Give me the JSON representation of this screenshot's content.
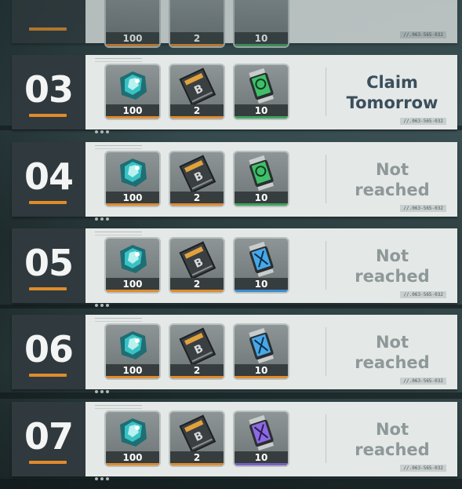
{
  "colors": {
    "orange": "#e08b2c",
    "green": "#3fa35c",
    "blue": "#3b8ccf",
    "purple": "#7a5fc0",
    "status_claim": "#3a4f5c",
    "status_locked": "#8e9898"
  },
  "partial_row": {
    "quantities": [
      "100",
      "2",
      "10"
    ],
    "code": "//.063-565-032"
  },
  "rows": [
    {
      "day": "03",
      "status": "Claim Tomorrow",
      "code": "//.063-565-032",
      "items": [
        {
          "icon": "crystal-icon",
          "qty": "100",
          "accent": "orange"
        },
        {
          "icon": "ticket-icon",
          "qty": "2",
          "accent": "orange"
        },
        {
          "icon": "canister-green-icon",
          "qty": "10",
          "accent": "green"
        }
      ]
    },
    {
      "day": "04",
      "status": "Not reached",
      "code": "//.063-565-032",
      "items": [
        {
          "icon": "crystal-icon",
          "qty": "100",
          "accent": "orange"
        },
        {
          "icon": "ticket-icon",
          "qty": "2",
          "accent": "orange"
        },
        {
          "icon": "canister-green-icon",
          "qty": "10",
          "accent": "green"
        }
      ]
    },
    {
      "day": "05",
      "status": "Not reached",
      "code": "//.063-565-032",
      "items": [
        {
          "icon": "crystal-icon",
          "qty": "100",
          "accent": "orange"
        },
        {
          "icon": "ticket-icon",
          "qty": "2",
          "accent": "orange"
        },
        {
          "icon": "canister-blue-icon",
          "qty": "10",
          "accent": "blue"
        }
      ]
    },
    {
      "day": "06",
      "status": "Not reached",
      "code": "//.063-565-032",
      "items": [
        {
          "icon": "crystal-icon",
          "qty": "100",
          "accent": "orange"
        },
        {
          "icon": "ticket-icon",
          "qty": "2",
          "accent": "orange"
        },
        {
          "icon": "canister-blue-icon",
          "qty": "10",
          "accent": "orange"
        }
      ]
    },
    {
      "day": "07",
      "status": "Not reached",
      "code": "//.063-565-032",
      "items": [
        {
          "icon": "crystal-icon",
          "qty": "100",
          "accent": "orange"
        },
        {
          "icon": "ticket-icon",
          "qty": "2",
          "accent": "orange"
        },
        {
          "icon": "canister-purple-icon",
          "qty": "10",
          "accent": "purple"
        }
      ]
    }
  ]
}
